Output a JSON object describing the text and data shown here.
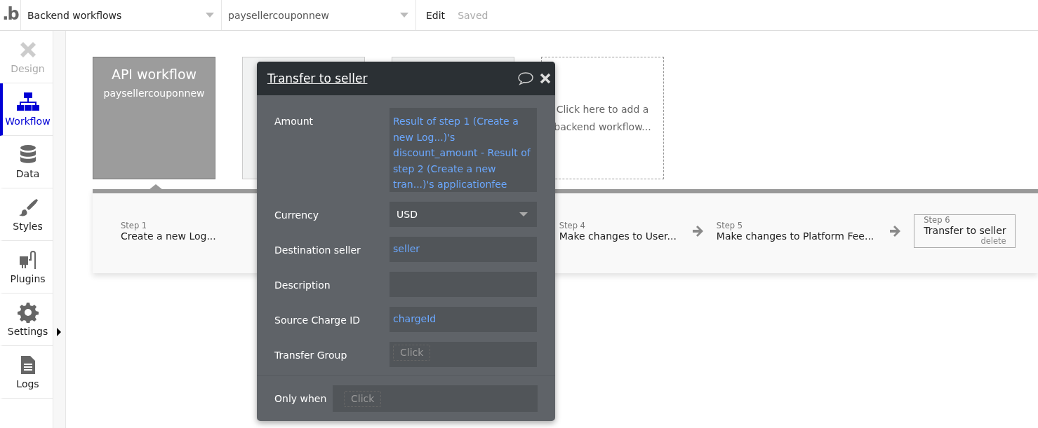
{
  "topbar": {
    "logo": ".b",
    "page_dropdown": "Backend workflows",
    "workflow_dropdown": "paysellercouponnew",
    "edit": "Edit",
    "status": "Saved"
  },
  "sidebar": {
    "items": [
      {
        "label": "Design",
        "selected": false,
        "disabled": true
      },
      {
        "label": "Workflow",
        "selected": true,
        "disabled": false
      },
      {
        "label": "Data",
        "selected": false,
        "disabled": false
      },
      {
        "label": "Styles",
        "selected": false,
        "disabled": false
      },
      {
        "label": "Plugins",
        "selected": false,
        "disabled": false
      },
      {
        "label": "Settings",
        "selected": false,
        "disabled": false
      },
      {
        "label": "Logs",
        "selected": false,
        "disabled": false
      }
    ]
  },
  "workflows": [
    {
      "kind": "api",
      "title": "API workflow",
      "name": "paysellercouponnew"
    },
    {
      "kind": "blank"
    },
    {
      "kind": "blank"
    },
    {
      "kind": "add",
      "title": "Click here to add a backend workflow..."
    }
  ],
  "steps": [
    {
      "label": "Step 1",
      "title": "Create a new Log...",
      "selected": false
    },
    {
      "kind": "hidden"
    },
    {
      "label": "Step 4",
      "title": "Make changes to User...",
      "selected": false
    },
    {
      "label": "Step 5",
      "title": "Make changes to Platform Fee...",
      "selected": false
    },
    {
      "label": "Step 6",
      "title": "Transfer to seller",
      "action": "delete",
      "selected": true
    }
  ],
  "popup": {
    "title": "Transfer to seller",
    "fields": [
      {
        "label": "Amount",
        "kind": "expression",
        "value": "Result of step 1 (Create a new Log...)'s discount_amount - Result of step 2 (Create a new tran...)'s applicationfee"
      },
      {
        "label": "Currency",
        "kind": "dropdown",
        "value": "USD"
      },
      {
        "label": "Destination seller",
        "kind": "expression",
        "value": "seller"
      },
      {
        "label": "Description",
        "kind": "empty"
      },
      {
        "label": "Source Charge ID",
        "kind": "expression",
        "value": "chargeId"
      },
      {
        "label": "Transfer Group",
        "kind": "click",
        "placeholder": "Click"
      }
    ],
    "condition": {
      "label": "Only when",
      "placeholder": "Click"
    }
  }
}
